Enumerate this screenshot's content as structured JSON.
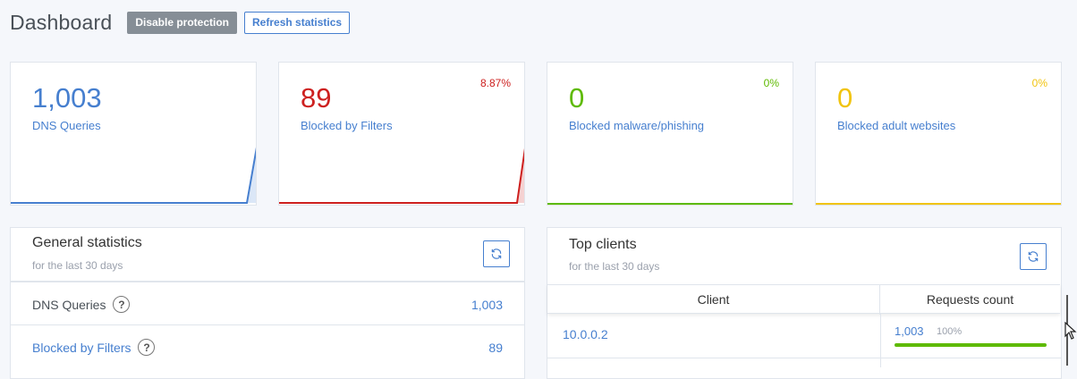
{
  "header": {
    "title": "Dashboard",
    "disable_label": "Disable protection",
    "refresh_label": "Refresh statistics"
  },
  "colors": {
    "blue": "#467fcf",
    "red": "#cd201f",
    "green": "#5eba00",
    "yellow": "#f1c40f"
  },
  "stats": [
    {
      "value": "1,003",
      "label": "DNS Queries",
      "percent": ""
    },
    {
      "value": "89",
      "label": "Blocked by Filters",
      "percent": "8.87%"
    },
    {
      "value": "0",
      "label": "Blocked malware/phishing",
      "percent": "0%"
    },
    {
      "value": "0",
      "label": "Blocked adult websites",
      "percent": "0%"
    }
  ],
  "general": {
    "title": "General statistics",
    "subtitle": "for the last 30 days",
    "refresh_icon": "refresh-icon",
    "rows": [
      {
        "label": "DNS Queries",
        "value": "1,003"
      },
      {
        "label": "Blocked by Filters",
        "value": "89"
      }
    ]
  },
  "top_clients": {
    "title": "Top clients",
    "subtitle": "for the last 30 days",
    "refresh_icon": "refresh-icon",
    "columns": [
      "Client",
      "Requests count"
    ],
    "rows": [
      {
        "client": "10.0.0.2",
        "count": "1,003",
        "percent": "100%",
        "fraction": 1.0
      }
    ]
  }
}
